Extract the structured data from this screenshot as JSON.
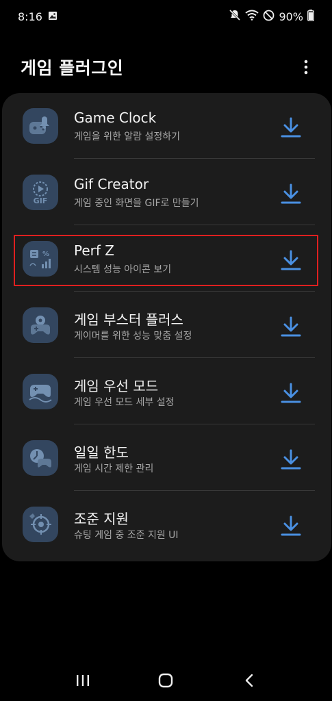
{
  "status_bar": {
    "time": "8:16",
    "battery": "90%",
    "icons": [
      "image-icon",
      "mute-icon",
      "wifi-icon",
      "do-not-disturb-icon",
      "battery-icon"
    ]
  },
  "header": {
    "title": "게임 플러그인",
    "more_icon": "more-vertical-icon"
  },
  "plugins": [
    {
      "title": "Game Clock",
      "subtitle": "게임을 위한 알람 설정하기",
      "icon": "game-clock-icon"
    },
    {
      "title": "Gif Creator",
      "subtitle": "게임 중인 화면을 GIF로 만들기",
      "icon": "gif-creator-icon",
      "icon_text": "GIF"
    },
    {
      "title": "Perf Z",
      "subtitle": "시스템 성능 아이콘 보기",
      "icon": "perf-z-icon",
      "icon_text": "%"
    },
    {
      "title": "게임 부스터 플러스",
      "subtitle": "게이머를 위한 성능 맞춤 설정",
      "icon": "game-booster-icon"
    },
    {
      "title": "게임 우선 모드",
      "subtitle": "게임 우선 모드 세부 설정",
      "icon": "game-priority-icon"
    },
    {
      "title": "일일 한도",
      "subtitle": "게임 시간 제한 관리",
      "icon": "daily-limit-icon"
    },
    {
      "title": "조준 지원",
      "subtitle": "슈팅 게임 중 조준 지원 UI",
      "icon": "aim-support-icon"
    }
  ],
  "colors": {
    "accent": "#4a90e2",
    "icon_bg": "#33465f",
    "card_bg": "#1c1c1c",
    "highlight": "#e02020"
  },
  "nav": {
    "recents_icon": "recents-icon",
    "home_icon": "home-icon",
    "back_icon": "back-icon"
  }
}
